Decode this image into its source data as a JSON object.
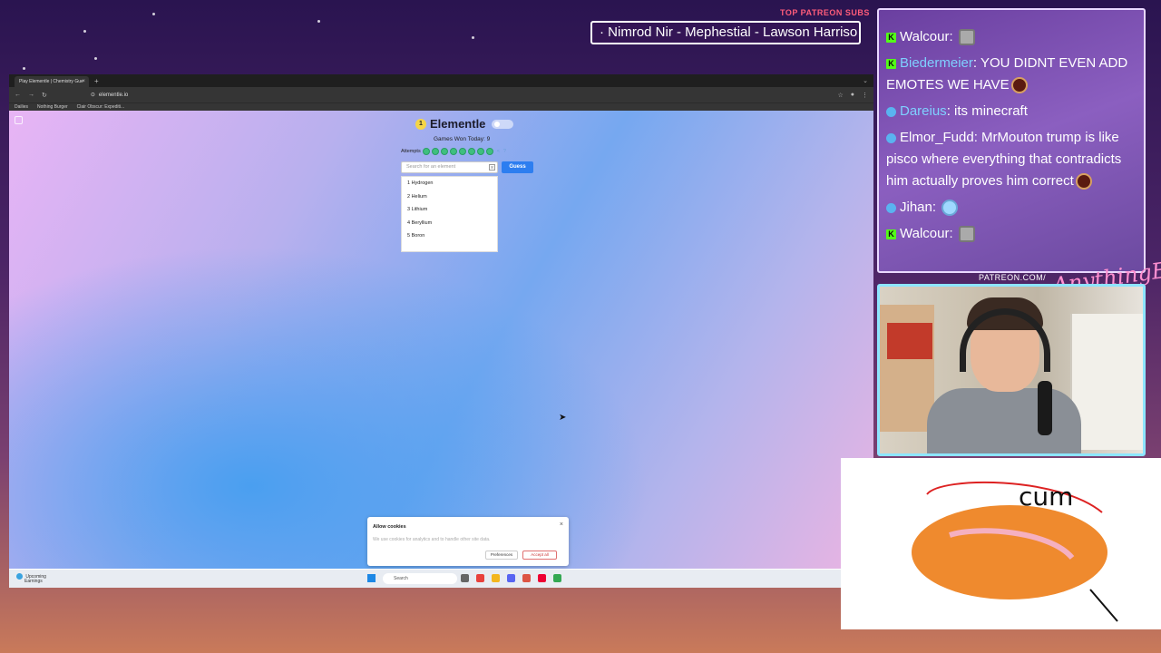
{
  "overlay": {
    "subs_title": "TOP PATREON SUBS",
    "subs_ticker": "· Nimrod Nir - Mephestial - Lawson Harriso",
    "patreon_url": "PATREON.COM/",
    "signature": "AnythingElse"
  },
  "browser": {
    "tab_title": "Play Elementle | Chemistry Gue",
    "tab_close": "×",
    "new_tab": "+",
    "url": "elementle.io",
    "bookmarks": [
      "Dailies",
      "Nothing Burger",
      "Clair Obscur: Expediti..."
    ]
  },
  "game": {
    "logo_badge": "1",
    "title": "Elementle",
    "games_won": "Games Won Today: 9",
    "attempts_label": "Attempts",
    "search_placeholder": "Search for an element",
    "guess_label": "Guess",
    "dropdown": [
      "1 Hydrogen",
      "2 Helium",
      "3 Lithium",
      "4 Beryllium",
      "5 Boron"
    ]
  },
  "cookie": {
    "title": "Allow cookies",
    "close": "×",
    "text": "We use cookies for analytics and to handle other site data.",
    "preferences": "Preferences",
    "accept": "Accept all"
  },
  "taskbar": {
    "weather_line1": "Upcoming",
    "weather_line2": "Earnings",
    "search": "Search"
  },
  "chat": {
    "messages": [
      {
        "badge": "kick",
        "user": "Walcour",
        "user_color": "#ffffff",
        "text": ""
      },
      {
        "badge": "kick",
        "user": "Biedermeier",
        "user_color": "#7fd0ff",
        "text": "YOU DIDNT EVEN ADD EMOTES WE HAVE"
      },
      {
        "badge": "discord",
        "user": "Dareius",
        "user_color": "#7fd0ff",
        "text": "its minecraft"
      },
      {
        "badge": "discord",
        "user": "Elmor_Fudd",
        "user_color": "#ffffff",
        "text": "MrMouton trump is like pisco where everything that contradicts him actually proves him correct"
      },
      {
        "badge": "discord",
        "user": "Jihan",
        "user_color": "#ffffff",
        "text": ""
      },
      {
        "badge": "kick",
        "user": "Walcour",
        "user_color": "#ffffff",
        "text": ""
      }
    ]
  },
  "drawing": {
    "text": "cum"
  },
  "colors": {
    "accent": "#2d7ef0",
    "chat_bg": "#7b4fb0",
    "attempt_dot": "#3fbf7f"
  }
}
